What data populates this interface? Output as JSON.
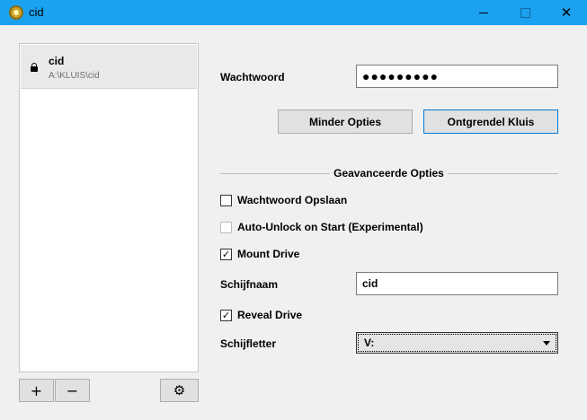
{
  "window": {
    "title": "cid",
    "close_glyph": "✕"
  },
  "vaults": [
    {
      "name": "cid",
      "path": "A:\\KLUIS\\cid",
      "locked": true
    }
  ],
  "list_toolbar": {
    "add_label": "+",
    "remove_label": "−",
    "settings_icon": "gear-icon",
    "settings_glyph": "⚙"
  },
  "unlock_form": {
    "password_label": "Wachtwoord",
    "password_value": "●●●●●●●●●",
    "less_options_label": "Minder Opties",
    "unlock_label": "Ontgrendel Kluis"
  },
  "advanced": {
    "heading": "Geavanceerde Opties",
    "save_password": {
      "label": "Wachtwoord Opslaan",
      "checked": false
    },
    "auto_unlock": {
      "label": "Auto-Unlock on Start (Experimental)",
      "checked": false,
      "enabled": false
    },
    "mount_drive": {
      "label": "Mount Drive",
      "checked": true
    },
    "drive_name_label": "Schijfnaam",
    "drive_name_value": "cid",
    "reveal_drive": {
      "label": "Reveal Drive",
      "checked": true
    },
    "drive_letter_label": "Schijfletter",
    "drive_letter_value": "V:",
    "check_glyph": "✓"
  },
  "colors": {
    "titlebar": "#1aa1f0",
    "focus_border": "#0078d7"
  }
}
